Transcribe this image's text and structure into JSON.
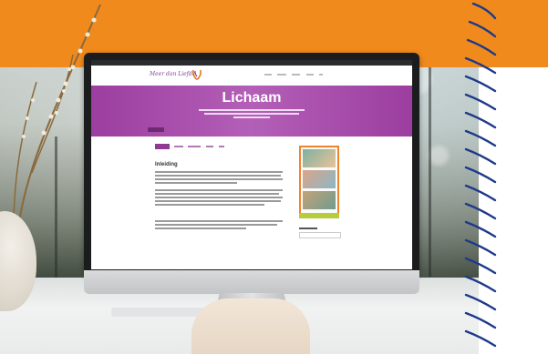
{
  "website": {
    "logo_text": "Meer dan Liefde",
    "hero_title": "Lichaam",
    "section_title": "Inleiding"
  },
  "colors": {
    "accent_orange": "#f08a1c",
    "wave_navy": "#1d3a8a",
    "site_purple": "#9c3ea0",
    "site_green": "#b7cc3a"
  },
  "icons": {
    "logo_mark": "heart-hands-icon"
  }
}
